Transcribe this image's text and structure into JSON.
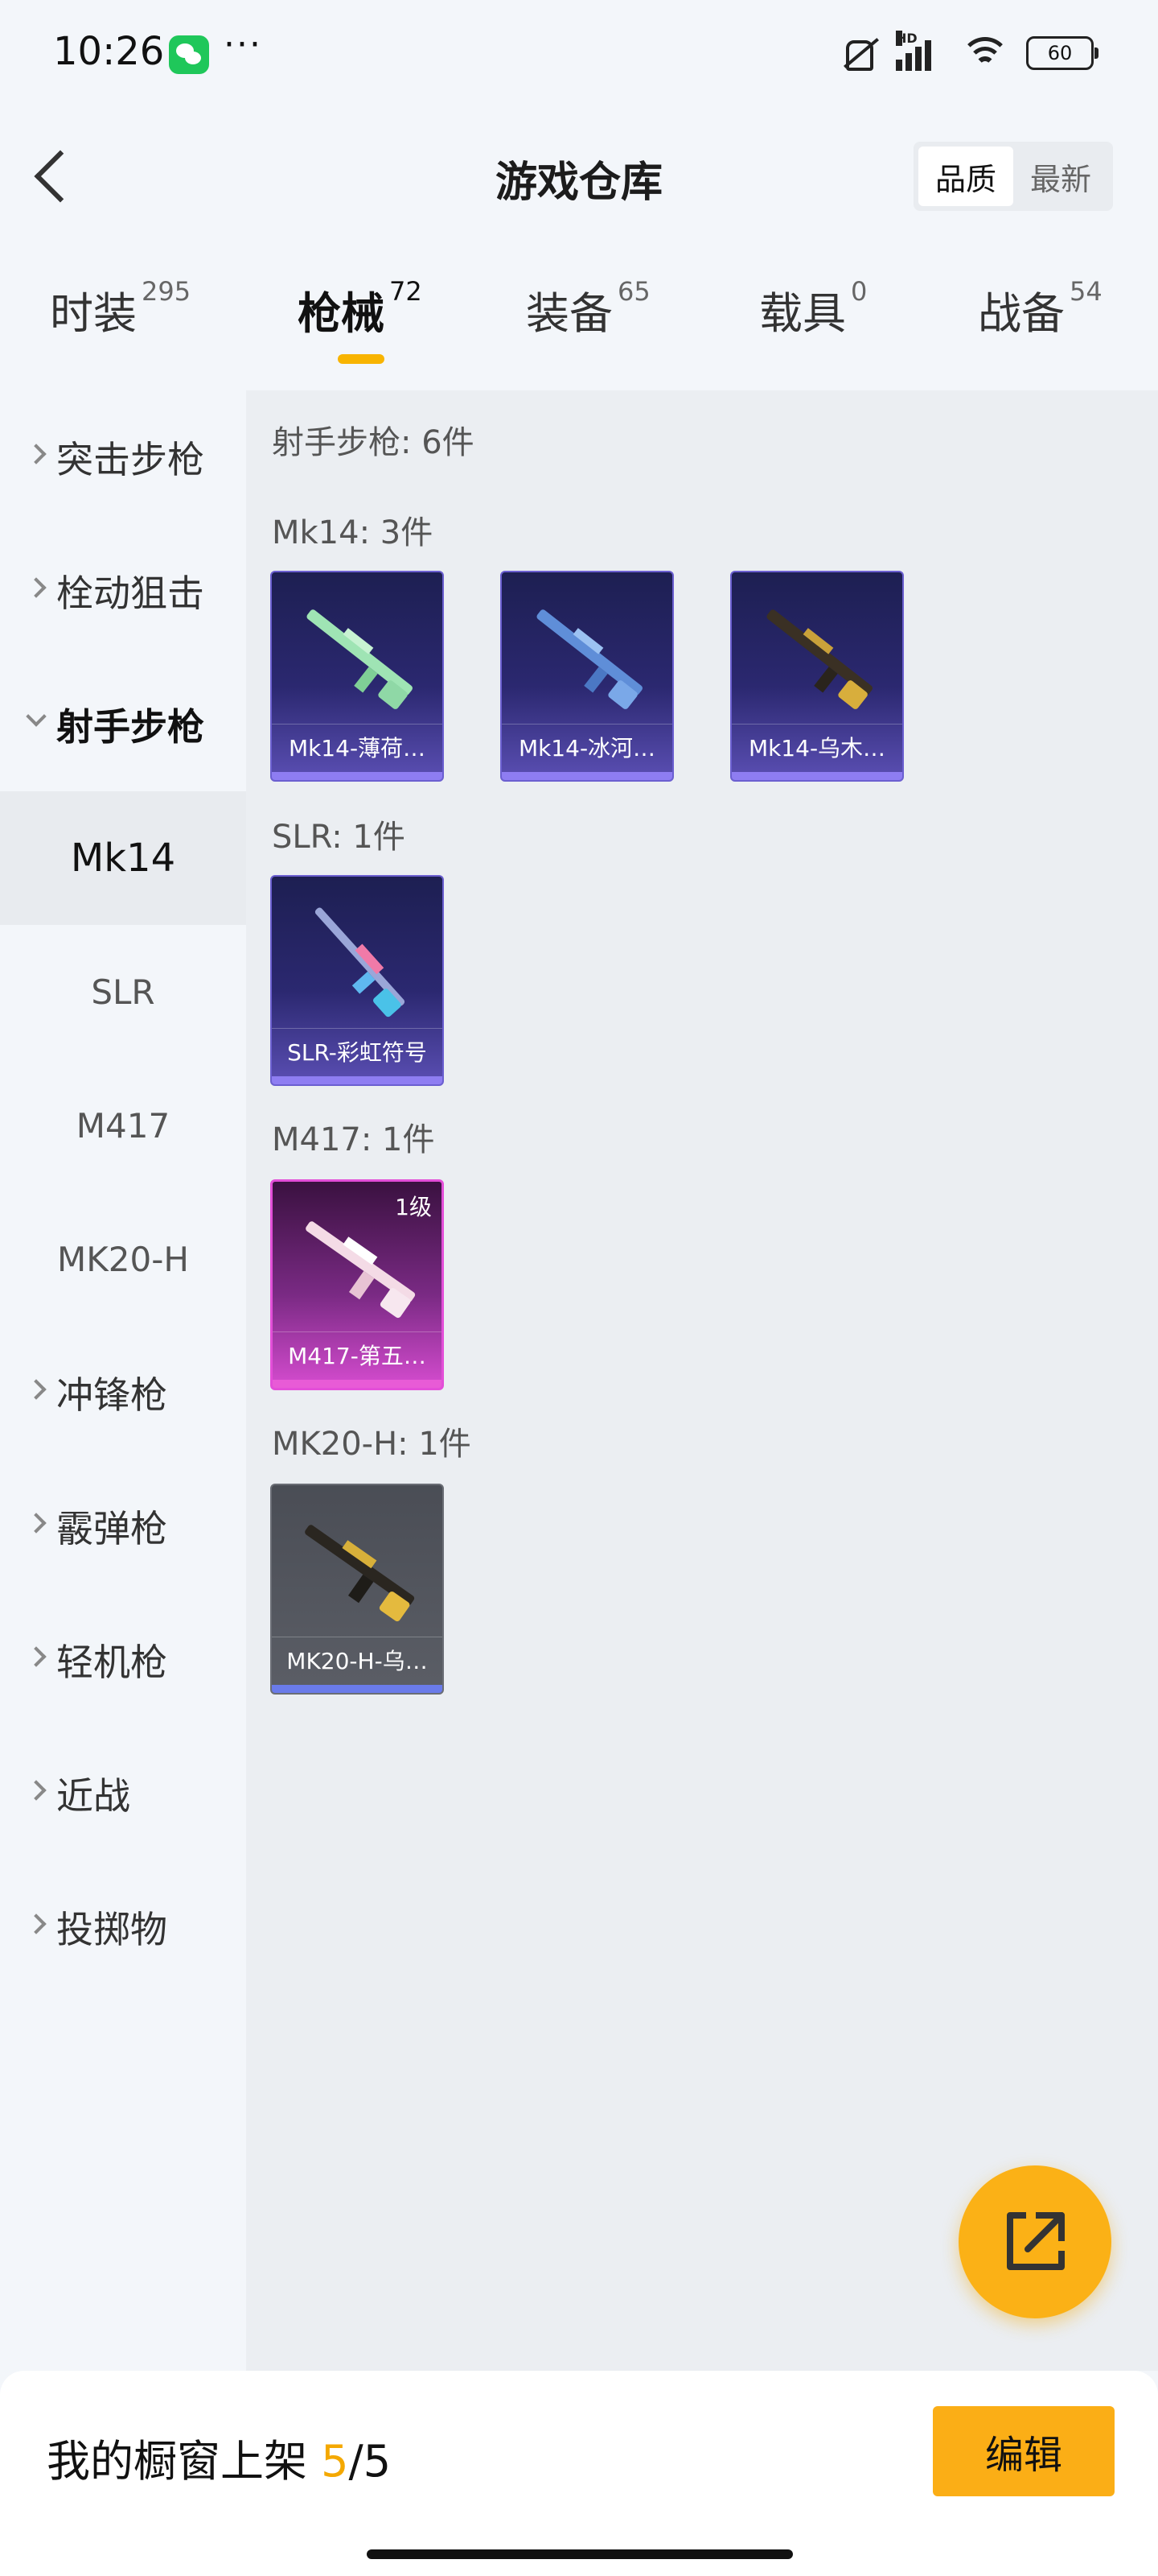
{
  "status_bar": {
    "time": "10:26",
    "more": "···",
    "battery": "60",
    "network": "HD"
  },
  "header": {
    "title": "游戏仓库",
    "sort_options": [
      "品质",
      "最新"
    ],
    "active_sort": "品质"
  },
  "tabs": [
    {
      "label": "时装",
      "count": "295"
    },
    {
      "label": "枪械",
      "count": "72",
      "active": true
    },
    {
      "label": "装备",
      "count": "65"
    },
    {
      "label": "载具",
      "count": "0"
    },
    {
      "label": "战备",
      "count": "54"
    }
  ],
  "sidebar": {
    "categories": [
      "突击步枪",
      "栓动狙击",
      "射手步枪",
      "冲锋枪",
      "霰弹枪",
      "轻机枪",
      "近战",
      "投掷物"
    ],
    "expanded": "射手步枪",
    "sub_items": [
      "Mk14",
      "SLR",
      "M417",
      "MK20-H"
    ],
    "active_sub": "Mk14"
  },
  "content": {
    "category_header": "射手步枪: 6件",
    "groups": [
      {
        "title": "Mk14: 3件",
        "items": [
          {
            "name": "Mk14-薄荷…",
            "rarity": "purple"
          },
          {
            "name": "Mk14-冰河…",
            "rarity": "purple"
          },
          {
            "name": "Mk14-乌木…",
            "rarity": "purple"
          }
        ]
      },
      {
        "title": "SLR: 1件",
        "items": [
          {
            "name": "SLR-彩虹符号",
            "rarity": "purple"
          }
        ]
      },
      {
        "title": "M417: 1件",
        "items": [
          {
            "name": "M417-第五…",
            "rarity": "pink",
            "badge": "1级"
          }
        ]
      },
      {
        "title": "MK20-H: 1件",
        "items": [
          {
            "name": "MK20-H-乌…",
            "rarity": "grey"
          }
        ]
      }
    ]
  },
  "fab": {
    "icon": "share-external-icon"
  },
  "bottom_bar": {
    "showcase_label": "我的橱窗上架",
    "current": "5",
    "separator": "/",
    "total": "5",
    "edit_label": "编辑"
  },
  "colors": {
    "accent": "#fbae16",
    "tab_underline": "#f8b400",
    "purple_rarity": "#8e7df2",
    "pink_rarity": "#e34ed8"
  }
}
